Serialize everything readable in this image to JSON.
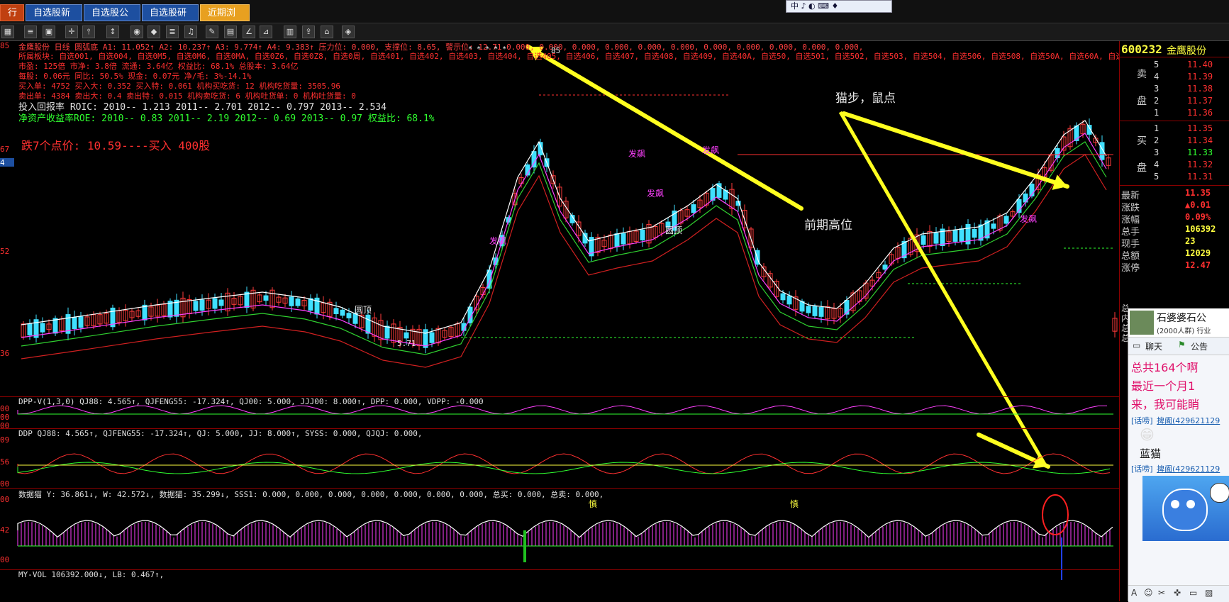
{
  "tabs": [
    {
      "label": "行情",
      "active": false
    },
    {
      "label": "自选股新闻",
      "active": false
    },
    {
      "label": "自选股公告",
      "active": false
    },
    {
      "label": "自选股研报",
      "active": false
    },
    {
      "label": "近期浏览",
      "active": true
    }
  ],
  "floatbar": {
    "label": "中 ♪ ◐ ⌨ ♦"
  },
  "price_axis": {
    "labels": [
      "85",
      "67",
      "52",
      "36"
    ],
    "marker": "4"
  },
  "info": {
    "line1": "金鹰股份 日线 圆弧底 A1: 11.052↑ A2: 10.237↑ A3: 9.774↑ A4: 9.383↑ 压力位: 0.000, 支撑位: 8.65, 警示位: 12.71 0.000, 0.000, 0.000, 0.000, 0.000, 0.000, 0.000, 0.000, 0.000, 0.000, 0.000,",
    "line2": "所属板块:      自选001, 自选004, 自选0M5, 自选0M6, 自选0MA, 自选0Z6, 自选0Z8, 自选0周, 自选401, 自选402, 自选403, 自选404, 自选405, 自选406, 自选407, 自选408, 自选409, 自选40A, 自选50, 自选501, 自选502, 自选503, 自选504, 自选506, 自选508, 自选50A, 自选60A, 自选A1, 自选A4, 自选Ax, 自选B,",
    "line3": "市盈: 125倍      市净: 3.8倍       流通: 3.64亿       权益比: 68.1%     总股本: 3.64亿",
    "line4": "每股: 0.06元     同比: 50.5%      现金: 0.07元       净/毛: 3%-14.1%",
    "line5": "买入单: 4752     买入大: 0.352    买入特: 0.061      机构买吃货: 12     机构吃货量: 3505.96",
    "line6": "卖出单: 4384     卖出大: 0.4      卖出特: 0.015      机构卖吃货: 6      机构吐货单: 0     机构吐货量: 0",
    "roic": "投入回报率 ROIC: 2010-- 1.213    2011-- 2.701    2012-- 0.797    2013-- 2.534",
    "roe": "净资产收益率ROE: 2010-- 0.83    2011-- 2.19    2012-- 0.69    2013-- 0.97    权益比: 68.1%",
    "buy_note": "跌7个点价: 10.59----买入 400股"
  },
  "annotations": {
    "cat_step": "猫步，鼠点",
    "prev_high": "前期高位",
    "yuanhu_top": "圆顶",
    "yuanhu_bottom": "圆顶",
    "fabiao": "发飙",
    "low_label": "5.71",
    "top_label": "85",
    "stars": "* * * * *"
  },
  "sub1": {
    "label": "DPP-V(1,3,0) QJ88: 4.565↑, QJFENG55: -17.324↑, QJ00: 5.000, JJJ00: 8.000↑, DPP: 0.000, VDPP: -0.000",
    "axis": [
      "00",
      "00",
      "00"
    ]
  },
  "sub2": {
    "label": "DDP QJ88: 4.565↑, QJFENG55: -17.324↑, QJ: 5.000, JJ: 8.000↑, SYSS: 0.000, QJQJ: 0.000,",
    "axis": [
      "09",
      "56",
      "00"
    ]
  },
  "sub3": {
    "label": "数据猫 Y: 36.861↓, W: 42.572↓, 数据猫: 35.299↓, SSS1: 0.000, 0.000, 0.000, 0.000, 0.000, 0.000, 0.000, 总买: 0.000, 总卖: 0.000,",
    "axis": [
      "00",
      "42",
      "00"
    ],
    "labels": [
      "慎",
      "慎"
    ]
  },
  "sub4": {
    "label": "MY-VOL 106392.000↓, LB: 0.467↑,"
  },
  "quote": {
    "code": "600232",
    "name": "金鹰股份",
    "sell_label": [
      "卖",
      "盘"
    ],
    "buy_label": [
      "买",
      "盘"
    ],
    "sell": [
      {
        "lvl": "5",
        "price": "11.40"
      },
      {
        "lvl": "4",
        "price": "11.39"
      },
      {
        "lvl": "3",
        "price": "11.38"
      },
      {
        "lvl": "2",
        "price": "11.37"
      },
      {
        "lvl": "1",
        "price": "11.36"
      }
    ],
    "buy": [
      {
        "lvl": "1",
        "price": "11.35"
      },
      {
        "lvl": "2",
        "price": "11.34"
      },
      {
        "lvl": "3",
        "price": "11.33"
      },
      {
        "lvl": "4",
        "price": "11.32"
      },
      {
        "lvl": "5",
        "price": "11.31"
      }
    ],
    "stats": [
      {
        "k": "最新",
        "v": "11.35"
      },
      {
        "k": "涨跌",
        "v": "▲0.01"
      },
      {
        "k": "涨幅",
        "v": "0.09%"
      },
      {
        "k": "总手",
        "v": "106392"
      },
      {
        "k": "现手",
        "v": "23"
      },
      {
        "k": "总额",
        "v": "12029"
      },
      {
        "k": "涨停",
        "v": "12.47"
      }
    ]
  },
  "chat": {
    "title": "石婆婆石公",
    "members": "(2000人群) 行业",
    "tab_chat": "聊天",
    "tab_notice": "公告",
    "msg1": "总共164个啊",
    "msg2": "最近一个月1",
    "msg3": "来，我可能睄",
    "tag1": "[话唠]",
    "user1": "捭阖(429621129",
    "emoji_face": "😁",
    "blue_cat": "蓝猫",
    "tag2": "[话唠]",
    "user2": "捭阖(429621129",
    "side_labels": [
      "总",
      "内",
      "总",
      "总"
    ]
  }
}
